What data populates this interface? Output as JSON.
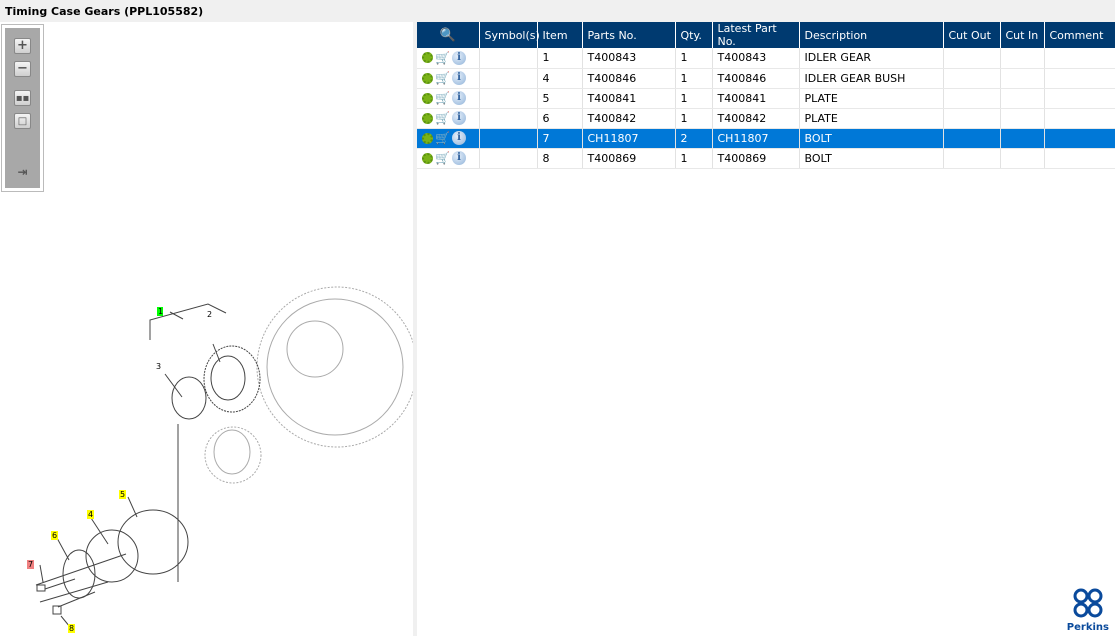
{
  "title": "Timing Case Gears (PPL105582)",
  "toolbar": {
    "zoom_in": "+",
    "zoom_out": "−"
  },
  "columns": [
    "",
    "Symbol(s)",
    "Item",
    "Parts No.",
    "Qty.",
    "Latest Part No.",
    "Description",
    "Cut Out",
    "Cut In",
    "Comment"
  ],
  "rows": [
    {
      "item": "1",
      "part": "T400843",
      "qty": "1",
      "latest": "T400843",
      "desc": "IDLER GEAR",
      "selected": false
    },
    {
      "item": "4",
      "part": "T400846",
      "qty": "1",
      "latest": "T400846",
      "desc": "IDLER GEAR BUSH",
      "selected": false
    },
    {
      "item": "5",
      "part": "T400841",
      "qty": "1",
      "latest": "T400841",
      "desc": "PLATE",
      "selected": false
    },
    {
      "item": "6",
      "part": "T400842",
      "qty": "1",
      "latest": "T400842",
      "desc": "PLATE",
      "selected": false
    },
    {
      "item": "7",
      "part": "CH11807",
      "qty": "2",
      "latest": "CH11807",
      "desc": "BOLT",
      "selected": true
    },
    {
      "item": "8",
      "part": "T400869",
      "qty": "1",
      "latest": "T400869",
      "desc": "BOLT",
      "selected": false
    }
  ],
  "diagram_labels": [
    "1",
    "2",
    "3",
    "4",
    "5",
    "6",
    "7",
    "8"
  ],
  "brand": "Perkins",
  "colors": {
    "header": "#003a70",
    "selected": "#0078d7",
    "callout_yellow": "#ffff00",
    "callout_green": "#00ff00",
    "callout_red": "#f08080"
  }
}
